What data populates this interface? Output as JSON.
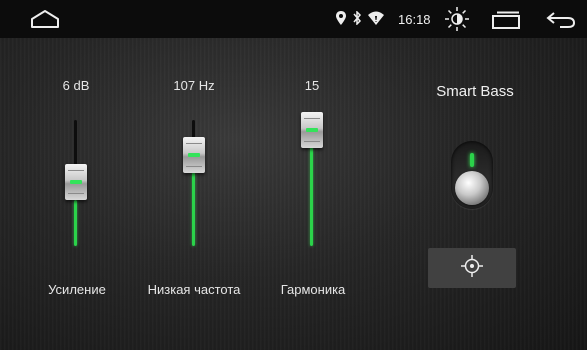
{
  "statusbar": {
    "time": "16:18"
  },
  "sliders": [
    {
      "value": "6 dB",
      "label": "Усиление",
      "level": 0.4
    },
    {
      "value": "107 Hz",
      "label": "Низкая частота",
      "level": 0.6
    },
    {
      "value": "15",
      "label": "Гармоника",
      "level": 1.0
    }
  ],
  "smart_bass": {
    "title": "Smart Bass",
    "enabled": true
  },
  "icons": {
    "home": "home-icon",
    "location": "location-icon",
    "bluetooth": "bluetooth-icon",
    "wifi": "wifi-icon",
    "brightness": "brightness-icon",
    "recents": "recents-icon",
    "back": "back-icon",
    "crosshair": "crosshair-icon"
  },
  "colors": {
    "accent_green": "#2bd34a"
  }
}
